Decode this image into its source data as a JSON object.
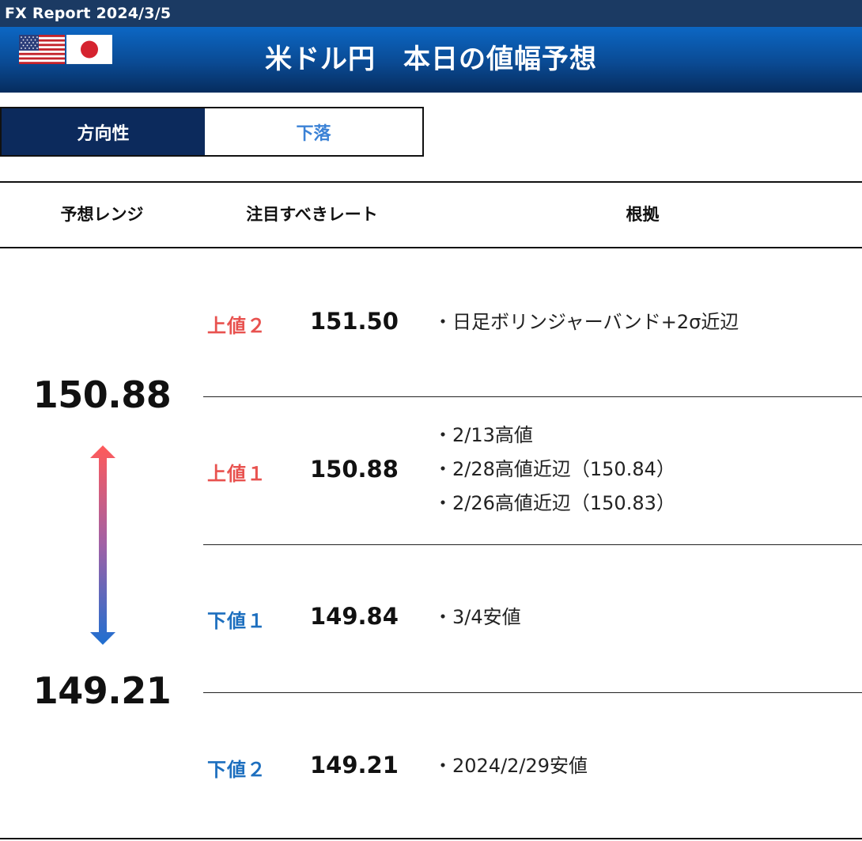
{
  "header": {
    "report_label": "FX Report 2024/3/5",
    "title": "米ドル円　本日の値幅予想"
  },
  "direction": {
    "label": "方向性",
    "value": "下落"
  },
  "columns": {
    "range": "予想レンジ",
    "rate": "注目すべきレート",
    "basis": "根拠"
  },
  "range": {
    "high": "150.88",
    "low": "149.21"
  },
  "levels": [
    {
      "label": "上値２",
      "rate": "151.50",
      "basis": [
        "・日足ボリンジャーバンド+2σ近辺"
      ]
    },
    {
      "label": "上値１",
      "rate": "150.88",
      "basis": [
        "・2/13高値",
        "・2/28高値近辺（150.84）",
        "・2/26高値近辺（150.83）"
      ]
    },
    {
      "label": "下値１",
      "rate": "149.84",
      "basis": [
        "・3/4安値"
      ]
    },
    {
      "label": "下値２",
      "rate": "149.21",
      "basis": [
        "・2024/2/29安値"
      ]
    }
  ],
  "colors": {
    "up": "#e8524f",
    "down": "#1d6fbf",
    "direction_value": "#3b82d6",
    "navy": "#0c2a5c"
  },
  "icons": [
    "us-flag-icon",
    "japan-flag-icon",
    "up-down-arrow-icon"
  ]
}
